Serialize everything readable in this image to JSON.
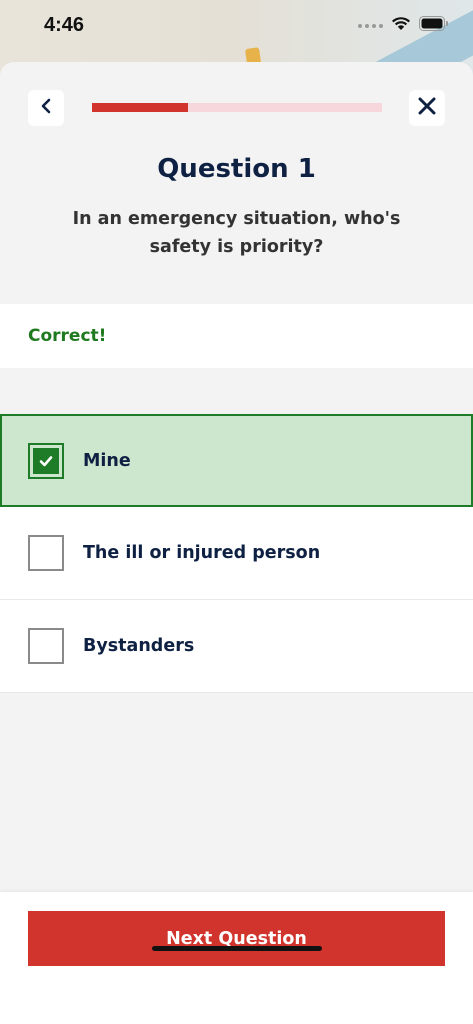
{
  "status_bar": {
    "time": "4:46",
    "icons": [
      "signal-icon",
      "wifi-icon",
      "battery-icon"
    ]
  },
  "quiz": {
    "progress": 0.33,
    "title": "Question 1",
    "question": "In an emergency situation, who's safety is priority?",
    "feedback": "Correct!",
    "options": [
      {
        "label": "Mine",
        "selected": true
      },
      {
        "label": "The ill or injured person",
        "selected": false
      },
      {
        "label": "Bystanders",
        "selected": false
      }
    ],
    "next_label": "Next Question"
  },
  "colors": {
    "accent": "#d0342c",
    "progress_track": "#f8d7dc",
    "correct": "#1e7b27",
    "selected_bg": "#cde6ce",
    "navy": "#0f2143"
  }
}
